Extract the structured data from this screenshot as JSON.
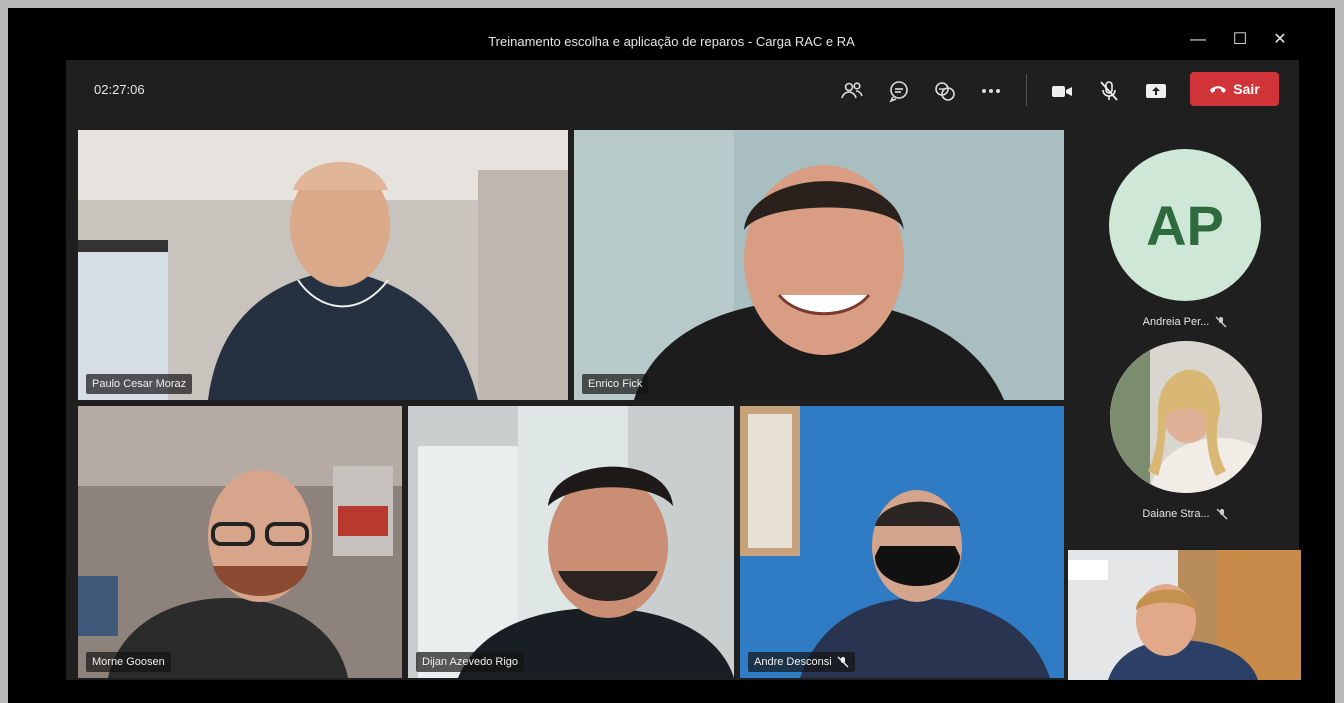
{
  "window": {
    "title": "Treinamento escolha e aplicação de reparos - Carga RAC e RA",
    "minimize": "—",
    "maximize": "☐",
    "close": "✕"
  },
  "toolbar": {
    "timer": "02:27:06",
    "icons": [
      "participants-icon",
      "chat-icon",
      "reactions-icon",
      "more-icon",
      "camera-icon",
      "mic-off-icon",
      "share-icon"
    ],
    "leave_label": "Sair",
    "leave_color": "#d13438"
  },
  "participants": [
    {
      "name": "Paulo Cesar Moraz",
      "active_speaker": true
    },
    {
      "name": "Enrico Fick",
      "active_speaker": false
    },
    {
      "name": "Morne Goosen",
      "active_speaker": true
    },
    {
      "name": "Dijan Azevedo Rigo",
      "active_speaker": false
    },
    {
      "name": "Andre Desconsi",
      "muted": true
    },
    {
      "name": "Andreia Per...",
      "initials": "AP",
      "muted": true
    },
    {
      "name": "Daiane Stra...",
      "muted": true
    }
  ],
  "colors": {
    "active_border": "#7b80cc",
    "avatar_bg": "#cfe7d6",
    "avatar_text": "#2d6b3f"
  }
}
